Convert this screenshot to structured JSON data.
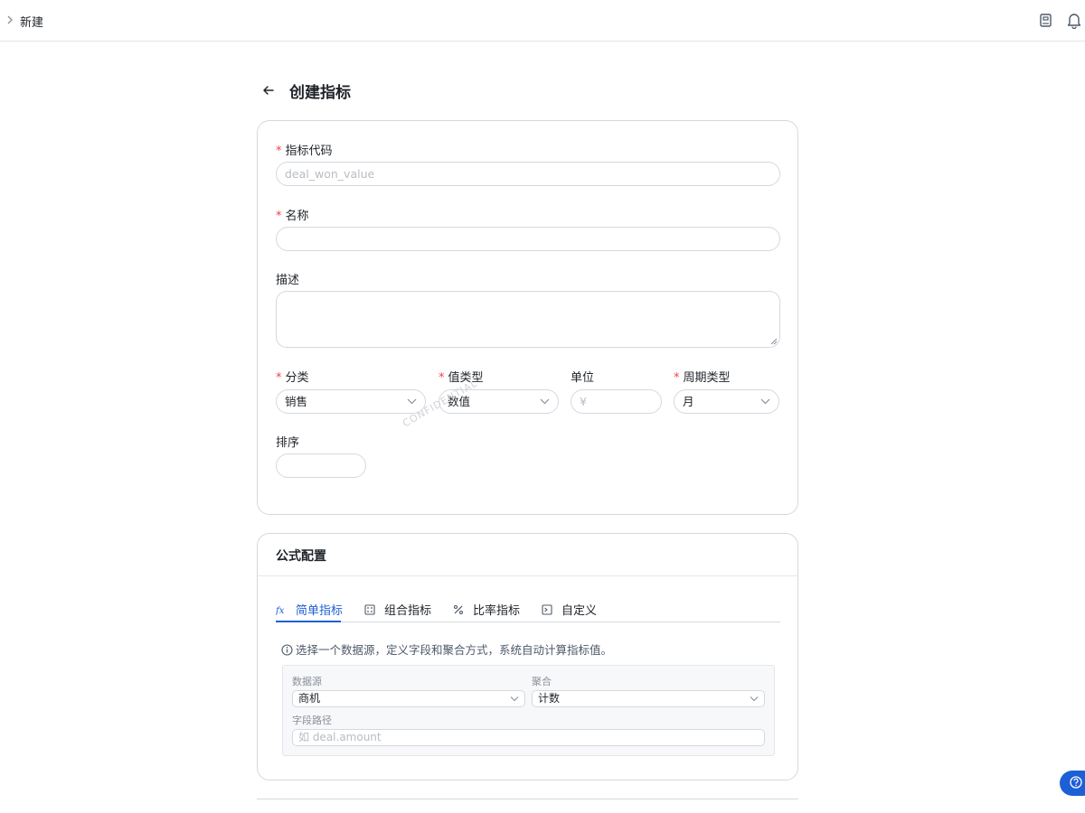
{
  "topbar": {
    "breadcrumb": "新建",
    "icons": [
      "chevron-right-icon",
      "book-icon",
      "bell-icon"
    ]
  },
  "page": {
    "title": "创建指标"
  },
  "basic": {
    "code_label": "指标代码",
    "code_placeholder": "deal_won_value",
    "name_label": "名称",
    "name_value": "",
    "desc_label": "描述",
    "category_label": "分类",
    "category_value": "销售",
    "value_type_label": "值类型",
    "value_type_value": "数值",
    "unit_label": "单位",
    "unit_placeholder": "¥",
    "period_label": "周期类型",
    "period_value": "月",
    "order_label": "排序",
    "order_value": "",
    "watermark": "CONFIDENTIAL"
  },
  "formula": {
    "title": "公式配置",
    "tabs": [
      {
        "label": "简单指标",
        "icon": "fx-icon",
        "active": true
      },
      {
        "label": "组合指标",
        "icon": "grid-icon",
        "active": false
      },
      {
        "label": "比率指标",
        "icon": "percent-icon",
        "active": false
      },
      {
        "label": "自定义",
        "icon": "terminal-icon",
        "active": false
      }
    ],
    "hint": "选择一个数据源，定义字段和聚合方式，系统自动计算指标值。",
    "datasource_label": "数据源",
    "datasource_value": "商机",
    "aggregate_label": "聚合",
    "aggregate_value": "计数",
    "field_label": "字段路径",
    "field_placeholder": "如 deal.amount"
  },
  "colors": {
    "accent": "#1d5fd6",
    "required": "#f53f3f",
    "border": "#d5d8de"
  }
}
